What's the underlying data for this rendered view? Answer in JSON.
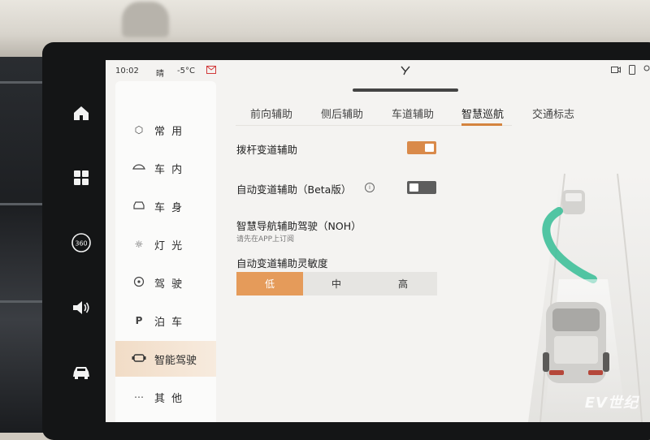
{
  "status": {
    "time": "10:02",
    "weather": "晴",
    "temperature": "-5°C"
  },
  "rail_icons": [
    "home-icon",
    "apps-grid-icon",
    "camera-360-icon",
    "volume-icon",
    "car-icon"
  ],
  "rail_labels": {
    "camera360": "360"
  },
  "sidebar": {
    "items": [
      {
        "label": "常 用",
        "icon": "cube-icon"
      },
      {
        "label": "车 内",
        "icon": "car-interior-icon"
      },
      {
        "label": "车 身",
        "icon": "car-body-icon"
      },
      {
        "label": "灯 光",
        "icon": "light-icon"
      },
      {
        "label": "驾 驶",
        "icon": "steering-wheel-icon"
      },
      {
        "label": "泊 车",
        "icon": "parking-icon"
      },
      {
        "label": "智能驾驶",
        "icon": "smart-drive-icon",
        "active": true
      },
      {
        "label": "其 他",
        "icon": "more-icon"
      }
    ]
  },
  "tabs": [
    {
      "label": "前向辅助"
    },
    {
      "label": "侧后辅助"
    },
    {
      "label": "车道辅助"
    },
    {
      "label": "智慧巡航",
      "active": true
    },
    {
      "label": "交通标志"
    }
  ],
  "settings": {
    "lever_lane_change": {
      "label": "拨杆变道辅助",
      "on": true
    },
    "auto_lane_change": {
      "label": "自动变道辅助（Beta版）",
      "on": false,
      "info": "i"
    },
    "noh": {
      "label": "智慧导航辅助驾驶（NOH）",
      "sublabel": "请先在APP上订阅"
    },
    "sensitivity": {
      "label": "自动变道辅助灵敏度",
      "options": [
        "低",
        "中",
        "高"
      ],
      "selected": "低"
    }
  },
  "colors": {
    "accent": "#e59b5a",
    "toggle_on": "#d98a4a",
    "toggle_off": "#5d5d5d",
    "path_green": "#3fc09a"
  },
  "watermark": "EV世纪"
}
